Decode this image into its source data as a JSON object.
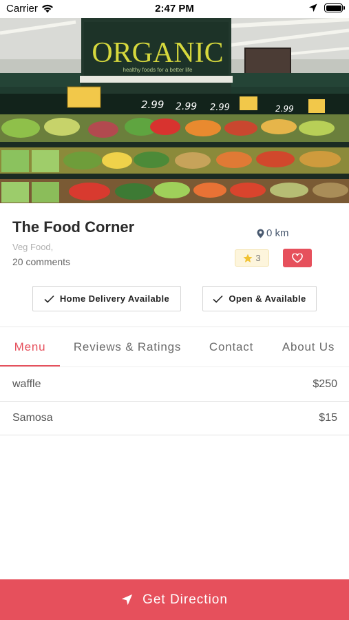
{
  "status_bar": {
    "carrier": "Carrier",
    "time": "2:47 PM"
  },
  "hero": {
    "sign_title": "ORGANIC",
    "sign_subtitle": "healthy foods for a better life",
    "price_tags": [
      "2.99",
      "2.99",
      "2.99",
      "2.99"
    ]
  },
  "restaurant": {
    "name": "The Food Corner",
    "cuisine": "Veg Food,",
    "comments": "20 comments",
    "distance": "0 km",
    "rating": "3"
  },
  "features": [
    "Home Delivery Available",
    "Open & Available"
  ],
  "tabs": [
    {
      "label": "Menu",
      "active": true
    },
    {
      "label": "Reviews & Ratings",
      "active": false
    },
    {
      "label": "Contact",
      "active": false
    },
    {
      "label": "About Us",
      "active": false
    }
  ],
  "menu_items": [
    {
      "name": "waffle",
      "price": "$250"
    },
    {
      "name": "Samosa",
      "price": "$15"
    }
  ],
  "cta": {
    "label": "Get Direction"
  },
  "colors": {
    "accent": "#e6505c",
    "rating_bg": "#fdf5dc",
    "star": "#f1c232",
    "distance": "#4a5a70"
  },
  "icons": [
    "wifi-icon",
    "location-arrow-icon",
    "battery-icon",
    "map-pin-icon",
    "star-icon",
    "heart-icon",
    "check-icon",
    "navigation-icon"
  ]
}
